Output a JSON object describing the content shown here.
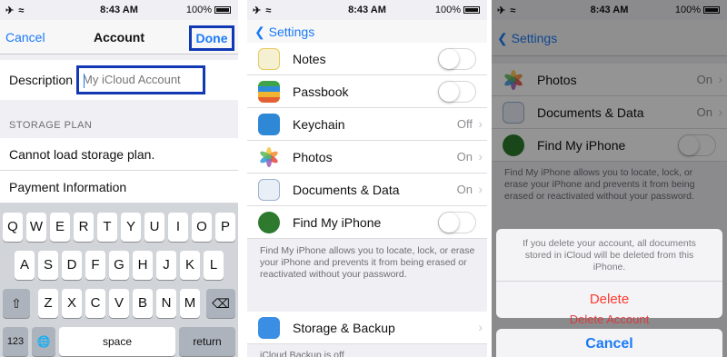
{
  "status": {
    "signal": "✈ ≈",
    "time": "8:43 AM",
    "battery": "100%"
  },
  "panel1": {
    "nav": {
      "cancel": "Cancel",
      "title": "Account",
      "done": "Done"
    },
    "description": {
      "label": "Description",
      "placeholder": "My iCloud Account"
    },
    "storage_header": "STORAGE PLAN",
    "rows": [
      "Cannot load storage plan.",
      "Payment Information"
    ],
    "keyboard": {
      "row1": [
        "Q",
        "W",
        "E",
        "R",
        "T",
        "Y",
        "U",
        "I",
        "O",
        "P"
      ],
      "row2": [
        "A",
        "S",
        "D",
        "F",
        "G",
        "H",
        "J",
        "K",
        "L"
      ],
      "row3": [
        "Z",
        "X",
        "C",
        "V",
        "B",
        "N",
        "M"
      ],
      "shift": "⇧",
      "backspace": "⌫",
      "numbers": "123",
      "globe": "🌐",
      "space": "space",
      "return": "return"
    }
  },
  "panel2": {
    "back": "Settings",
    "items": [
      {
        "label": "Notes",
        "toggle": true
      },
      {
        "label": "Passbook",
        "toggle": true
      },
      {
        "label": "Keychain",
        "value": "Off"
      },
      {
        "label": "Photos",
        "value": "On"
      },
      {
        "label": "Documents & Data",
        "value": "On"
      },
      {
        "label": "Find My iPhone",
        "toggle": true
      }
    ],
    "find_note": "Find My iPhone allows you to locate, lock, or erase your iPhone and prevents it from being erased or reactivated without your password.",
    "storage": {
      "label": "Storage & Backup"
    },
    "backup_note": "iCloud Backup is off"
  },
  "panel3": {
    "back": "Settings",
    "items": [
      {
        "label": "Photos",
        "value": "On"
      },
      {
        "label": "Documents & Data",
        "value": "On"
      },
      {
        "label": "Find My iPhone",
        "toggle": true
      }
    ],
    "find_note": "Find My iPhone allows you to locate, lock, or erase your iPhone and prevents it from being erased or reactivated without your password.",
    "sheet": {
      "message": "If you delete your account, all documents stored in iCloud will be deleted from this iPhone.",
      "delete": "Delete",
      "under": "Delete Account",
      "cancel": "Cancel"
    }
  },
  "colors": {
    "ios_blue": "#1a7af8",
    "highlight_box": "#1238b4",
    "destructive": "#ff3b30"
  }
}
